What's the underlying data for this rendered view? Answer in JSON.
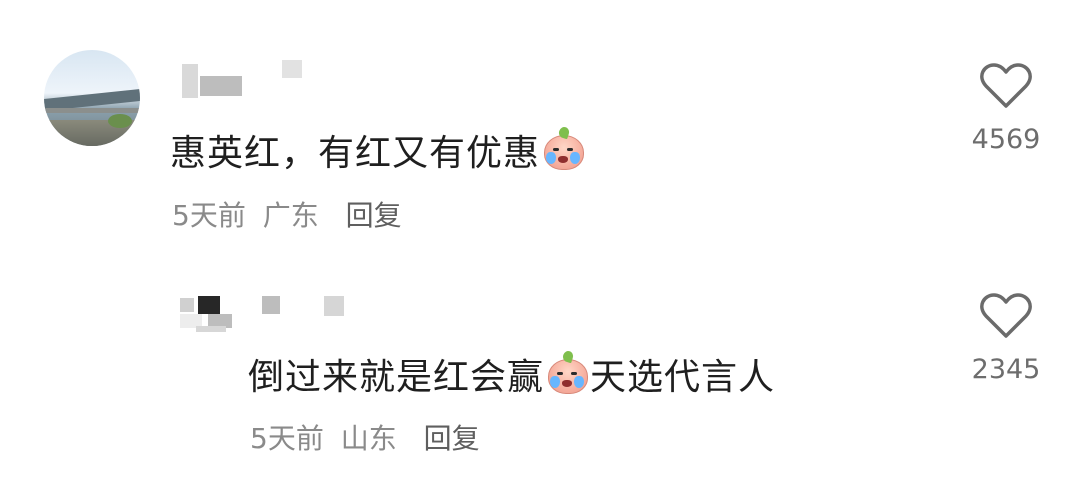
{
  "comments": [
    {
      "text_before": "惠英红，有红又有优惠",
      "emoji_icon": "crying-face-icon",
      "text_after": "",
      "time": "5天前",
      "location": "广东",
      "reply_label": "回复",
      "likes": "4569"
    },
    {
      "text_before": "倒过来就是红会赢",
      "emoji_icon": "crying-face-icon",
      "text_after": "天选代言人",
      "time": "5天前",
      "location": "山东",
      "reply_label": "回复",
      "likes": "2345"
    }
  ],
  "colors": {
    "text": "#1f1f1f",
    "meta": "#8a8a8a",
    "heart_outline": "#6b6b6b"
  }
}
